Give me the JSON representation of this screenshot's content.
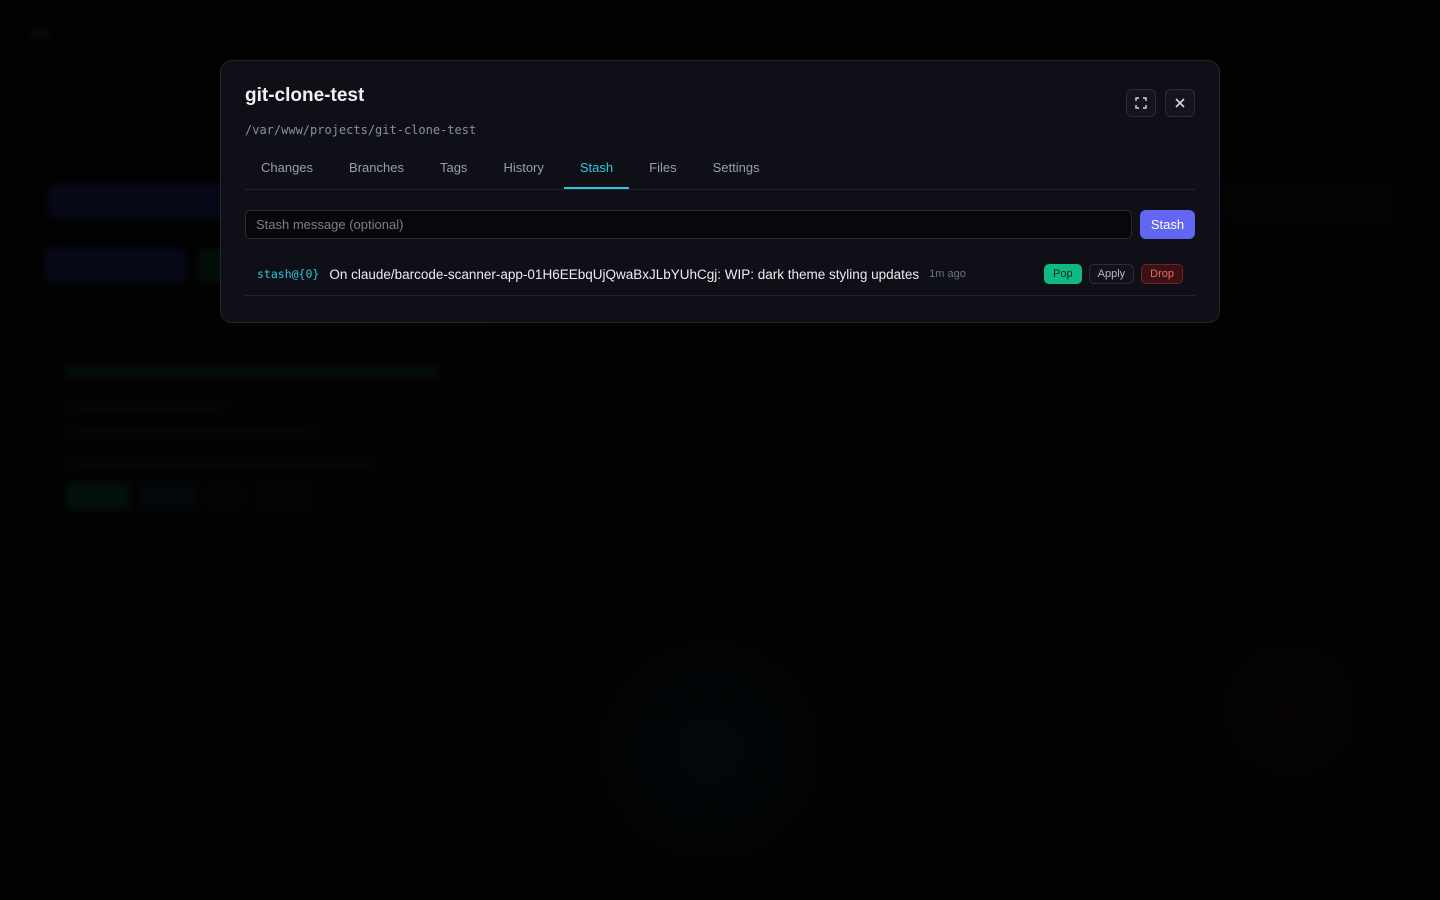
{
  "modal": {
    "title": "git-clone-test",
    "path": "/var/www/projects/git-clone-test",
    "tabs": [
      {
        "label": "Changes",
        "active": false
      },
      {
        "label": "Branches",
        "active": false
      },
      {
        "label": "Tags",
        "active": false
      },
      {
        "label": "History",
        "active": false
      },
      {
        "label": "Stash",
        "active": true
      },
      {
        "label": "Files",
        "active": false
      },
      {
        "label": "Settings",
        "active": false
      }
    ],
    "icons": {
      "fullscreen": "expand-icon",
      "close": "close-icon"
    }
  },
  "stash": {
    "input_value": "",
    "input_placeholder": "Stash message (optional)",
    "button_label": "Stash",
    "entries": [
      {
        "ref": "stash@{0}",
        "message": "On claude/barcode-scanner-app-01H6EEbqUjQwaBxJLbYUhCgj: WIP: dark theme styling updates",
        "time": "1m ago",
        "actions": {
          "pop": "Pop",
          "apply": "Apply",
          "drop": "Drop"
        }
      }
    ]
  },
  "colors": {
    "accent": "#2fc6dd",
    "primary": "#6366f1",
    "success": "#10b981",
    "danger": "#f26b6b"
  }
}
